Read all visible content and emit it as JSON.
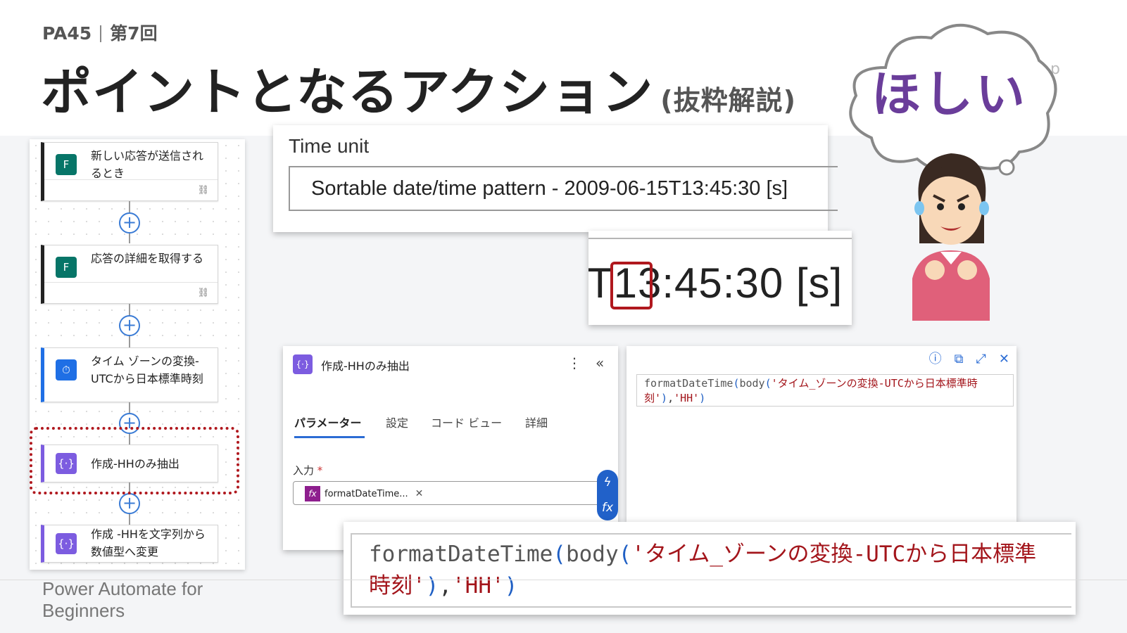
{
  "header": {
    "course": "PA45",
    "session": "第7回",
    "title": "ポイントとなるアクション",
    "subtitle": "(抜粋解説)"
  },
  "footer": {
    "line1": "Power Automate for",
    "line2": "Beginners"
  },
  "flow": {
    "steps": [
      {
        "label": "新しい応答が送信されるとき",
        "icon": "microsoft-forms-icon",
        "link_icon": "link-icon"
      },
      {
        "label": "応答の詳細を取得する",
        "icon": "microsoft-forms-icon",
        "link_icon": "link-icon"
      },
      {
        "label": "タイム ゾーンの変換-UTCから日本標準時刻",
        "icon": "clock-icon"
      },
      {
        "label": "作成-HHのみ抽出",
        "icon": "compose-icon"
      },
      {
        "label": "作成 -HHを文字列から数値型へ変更",
        "icon": "compose-icon"
      }
    ],
    "add_symbol": "+"
  },
  "time_unit": {
    "label": "Time unit",
    "value": "Sortable date/time pattern - 2009-06-15T13:45:30 [s]"
  },
  "zoom": {
    "text": "T13:45:30 [s]"
  },
  "cloud": {
    "text": "ほしい"
  },
  "compose": {
    "title": "作成-HHのみ抽出",
    "more": "⋮",
    "collapse": "«",
    "tabs": [
      "パラメーター",
      "設定",
      "コード ビュー",
      "詳細"
    ],
    "input_label": "入力",
    "required_mark": "*",
    "token_text": "formatDateTime...",
    "token_fx": "fx",
    "token_remove": "✕",
    "side_button_1": "ϟ",
    "side_button_2": "fx"
  },
  "expression": {
    "fn": "formatDateTime",
    "body_fn": "body",
    "arg": "'タイム_ゾーンの変換-UTCから日本標準時刻'",
    "format": "'HH'",
    "toolbar": [
      "ⓘ",
      "⧉",
      "⤢",
      "✕"
    ]
  },
  "tiny_text": "p"
}
